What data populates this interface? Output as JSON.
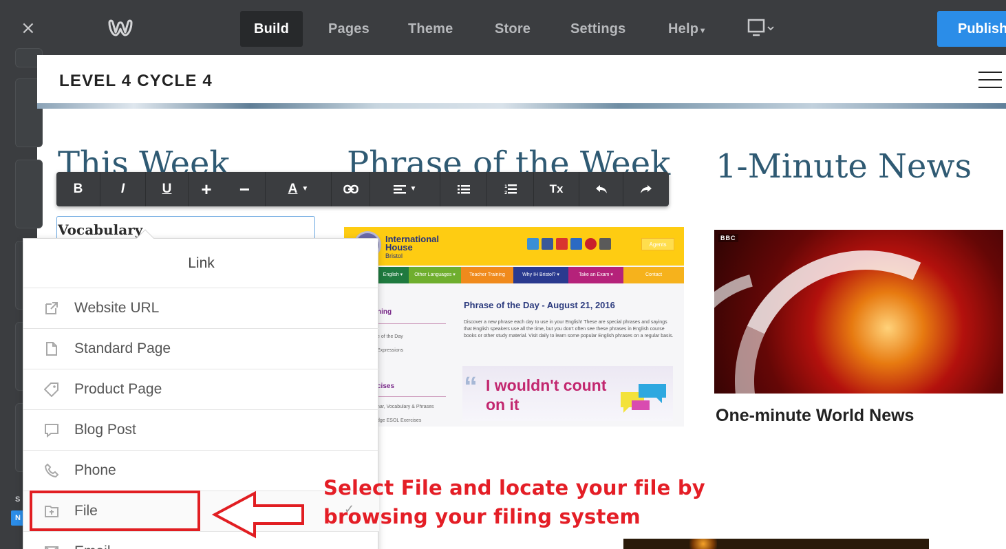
{
  "topbar": {
    "close_label": "×",
    "tabs": [
      "Build",
      "Pages",
      "Theme",
      "Store",
      "Settings",
      "Help"
    ],
    "device_icon": "monitor-icon",
    "publish_label": "Publish"
  },
  "site": {
    "title": "LEVEL 4 CYCLE 4"
  },
  "columns": {
    "col1_heading": "This Week",
    "col2_heading": "Phrase of the Week",
    "col3_heading": "1-Minute News",
    "col1_text": "Vocabulary"
  },
  "toolbar": {
    "bold": "B",
    "italic": "I",
    "underline": "U",
    "increase_font": "+",
    "decrease_font": "−",
    "text_color": "A",
    "link_icon": "link-icon",
    "align_icon": "align-icon",
    "bullet_list_icon": "bullet-list-icon",
    "numbered_list_icon": "numbered-list-icon",
    "clear_format": "Tx",
    "undo_icon": "undo-icon",
    "redo_icon": "redo-icon"
  },
  "link_menu": {
    "title": "Link",
    "items": [
      {
        "label": "Website URL",
        "icon": "external-link-icon"
      },
      {
        "label": "Standard Page",
        "icon": "page-icon"
      },
      {
        "label": "Product Page",
        "icon": "tag-icon"
      },
      {
        "label": "Blog Post",
        "icon": "comment-icon"
      },
      {
        "label": "Phone",
        "icon": "phone-icon"
      },
      {
        "label": "File",
        "icon": "file-upload-icon"
      },
      {
        "label": "Email",
        "icon": "email-icon"
      }
    ]
  },
  "annotation": {
    "line1": "Select File and locate your file by",
    "line2": "browsing your filing system"
  },
  "ih_image": {
    "brand_line1": "International",
    "brand_line2": "House",
    "brand_line3": "Bristol",
    "agents": "Agents",
    "menu": [
      "English ▾",
      "Other Languages ▾",
      "Teacher Training",
      "Why IH Bristol? ▾",
      "Take an Exam ▾",
      "Contact"
    ],
    "side_heading1": "ning",
    "side_item1": "e of the Day",
    "side_item2": "Expressions",
    "side_heading2": "cises",
    "side_item3": "nar, Vocabulary & Phrases",
    "side_item4": "dge ESOL Exercises",
    "heading": "Phrase of the Day - August 21, 2016",
    "body": "Discover a new phrase each day to use in your English! These are special phrases and sayings that English speakers use all the time, but you don't often see these phrases in English course books or other study material. Visit daily to learn some popular English phrases on a regular basis.",
    "phrase_line1": "I wouldn't count",
    "phrase_line2": "on it"
  },
  "bbc_image": {
    "tag": "BBC"
  },
  "news": {
    "caption": "One-minute World News"
  },
  "sidebar": {
    "letter": "S",
    "badge": "N"
  },
  "colors": {
    "topbar": "#3b3d40",
    "publish": "#2b8de8",
    "heading": "#2f5a73",
    "annotation": "#e41e26"
  }
}
